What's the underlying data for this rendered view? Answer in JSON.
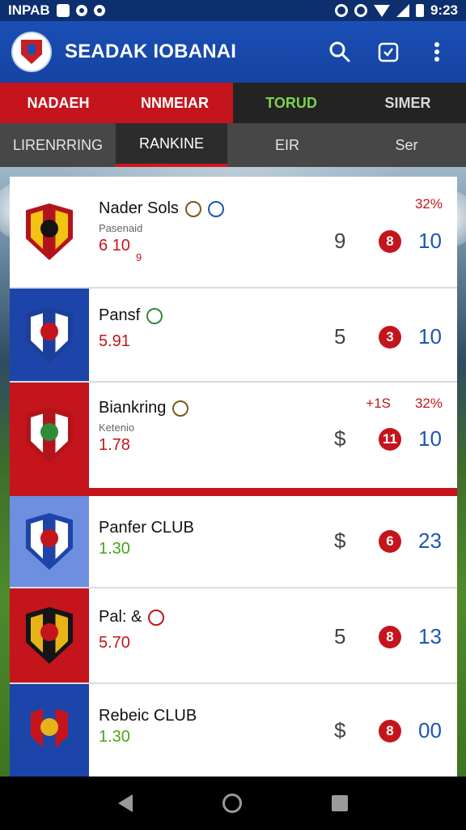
{
  "status_bar": {
    "left_text": "INPAB",
    "time": "9:23"
  },
  "app_bar": {
    "title": "SEADAK IOBANAI",
    "icons": [
      "search-icon",
      "calendar-check-icon",
      "more-vert-icon"
    ]
  },
  "top_tabs": [
    {
      "label": "NADAEH"
    },
    {
      "label": "NNMEIAR"
    },
    {
      "label": "TORUD"
    },
    {
      "label": "SIMER"
    }
  ],
  "sub_tabs": [
    {
      "label": "LIRENRRING"
    },
    {
      "label": "RANKINE",
      "active": true
    },
    {
      "label": "EIR"
    },
    {
      "label": "Ser"
    }
  ],
  "rankings": [
    {
      "name": "Nader Sols",
      "sub": "Pasenaid",
      "value": "6 10",
      "value_extra": "9",
      "stat_a": "9",
      "badge": "8",
      "stat_c": "10",
      "pct": "32%",
      "delta": "",
      "crest_colors": [
        "#b3141b",
        "#f2c311",
        "#141414"
      ],
      "box_color": "#ffffff",
      "value_color": "#c4151c"
    },
    {
      "name": "Pansf",
      "sub": "",
      "value": "5.91",
      "value_extra": "",
      "stat_a": "5",
      "badge": "3",
      "stat_c": "10",
      "pct": "",
      "delta": "",
      "crest_colors": [
        "#1d3f9c",
        "#ffffff",
        "#c4151c"
      ],
      "box_color": "#1d44a8",
      "value_color": "#c4151c"
    },
    {
      "name": "Biankring",
      "sub": "Ketenio",
      "value": "1.78",
      "value_extra": "",
      "stat_a": "$",
      "badge": "11",
      "stat_c": "10",
      "pct": "32%",
      "delta": "+1S",
      "crest_colors": [
        "#b3141b",
        "#ffffff",
        "#2e8b3a"
      ],
      "box_color": "#c4151c",
      "value_color": "#c4151c"
    },
    {
      "name": "Panfer CLUB",
      "sub": "",
      "value": "1.30",
      "value_extra": "",
      "stat_a": "$",
      "badge": "6",
      "stat_c": "23",
      "pct": "",
      "delta": "",
      "crest_colors": [
        "#1d44a8",
        "#ffffff",
        "#c4151c"
      ],
      "box_color": "#6e8ee0",
      "value_color": "#48a51d"
    },
    {
      "name": "Pal: &",
      "sub": "",
      "value": "5.70",
      "value_extra": "",
      "stat_a": "5",
      "badge": "8",
      "stat_c": "13",
      "pct": "",
      "delta": "",
      "crest_colors": [
        "#151515",
        "#e6b319",
        "#c4151c"
      ],
      "box_color": "#c4151c",
      "value_color": "#c4151c"
    },
    {
      "name": "Rebeic CLUB",
      "sub": "",
      "value": "1.30",
      "value_extra": "",
      "stat_a": "$",
      "badge": "8",
      "stat_c": "00",
      "pct": "",
      "delta": "",
      "crest_colors": [
        "#1d44a8",
        "#c4151c",
        "#e6b319"
      ],
      "box_color": "#1d44a8",
      "value_color": "#48a51d"
    }
  ]
}
